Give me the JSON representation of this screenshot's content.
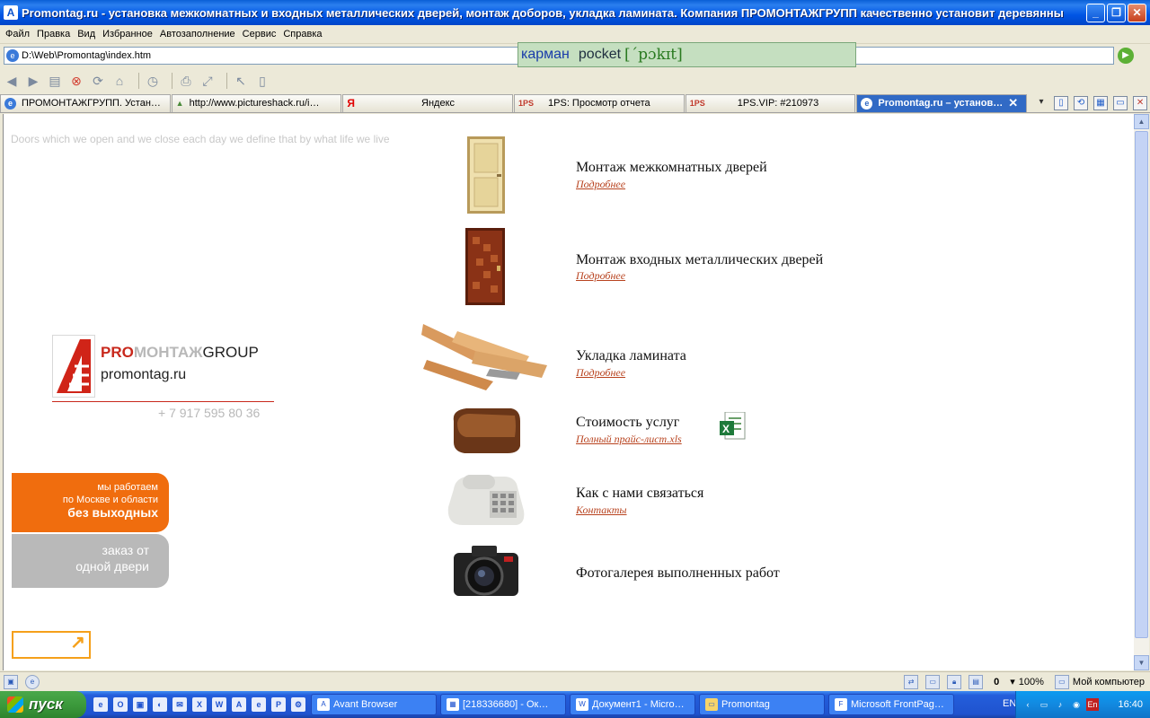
{
  "window": {
    "title": "Promontag.ru - установка межкомнатных и входных металлических дверей, монтаж доборов, укладка ламината. Компания ПРОМОНТАЖГРУПП качественно установит деревянны",
    "minimize": "_",
    "maximize": "❐",
    "close": "✕"
  },
  "menu": [
    "Файл",
    "Правка",
    "Вид",
    "Избранное",
    "Автозаполнение",
    "Сервис",
    "Справка"
  ],
  "address": {
    "value": "D:\\Web\\Promontag\\index.htm"
  },
  "dictionary_popup": {
    "word": "карман",
    "translation": "pocket",
    "transcription": "[ˊpɔkɪt]"
  },
  "tabs": [
    {
      "label": "ПРОМОНТАЖГРУПП. Устан…",
      "icon": "ie"
    },
    {
      "label": "http://www.pictureshack.ru/i…",
      "icon": "img"
    },
    {
      "label": "Яндекс",
      "icon": "Я"
    },
    {
      "label": "1PS: Просмотр отчета",
      "icon": "1PS"
    },
    {
      "label": "1PS.VIP: #210973",
      "icon": "1PS"
    },
    {
      "label": "Promontag.ru – установ…",
      "icon": "ie",
      "active": true
    }
  ],
  "page": {
    "tagline": "Doors which we open and we close each day we define that by what life we live",
    "logo": {
      "pro": "PRO",
      "montazh": "МОНТАЖ",
      "group": "GROUP",
      "site": "promontag.ru",
      "phone": "+ 7 917 595 80 36"
    },
    "promo_orange": {
      "line1": "мы работаем",
      "line2": "по Москве и области",
      "line3": "без выходных"
    },
    "promo_gray": {
      "line1": "заказ от",
      "line2": "одной двери"
    },
    "services": [
      {
        "title": "Монтаж межкомнатных дверей",
        "link": "Подробнее",
        "icon": "interior-door-icon"
      },
      {
        "title": "Монтаж входных металлических дверей",
        "link": "Подробнее",
        "icon": "metal-door-icon"
      },
      {
        "title": "Укладка ламината",
        "link": "Подробнее",
        "icon": "laminate-icon"
      },
      {
        "title": "Стоимость услуг",
        "link": "Полный прайс-лист.xls",
        "icon": "wallet-icon"
      },
      {
        "title": "Как с нами связаться",
        "link": "Контакты",
        "icon": "phone-icon"
      },
      {
        "title": "Фотогалерея выполненных работ",
        "link": "",
        "icon": "camera-icon"
      }
    ]
  },
  "statusbar": {
    "count": "0",
    "zoom": "100%",
    "zone": "Мой компьютер"
  },
  "taskbar": {
    "start": "пуск",
    "buttons": [
      {
        "label": "Avant Browser"
      },
      {
        "label": "[218336680] - Ок…"
      },
      {
        "label": "Документ1 - Micro…"
      },
      {
        "label": "Promontag"
      },
      {
        "label": "Microsoft FrontPag…"
      }
    ],
    "lang": "EN",
    "keyboard": "En",
    "clock": "16:40"
  }
}
